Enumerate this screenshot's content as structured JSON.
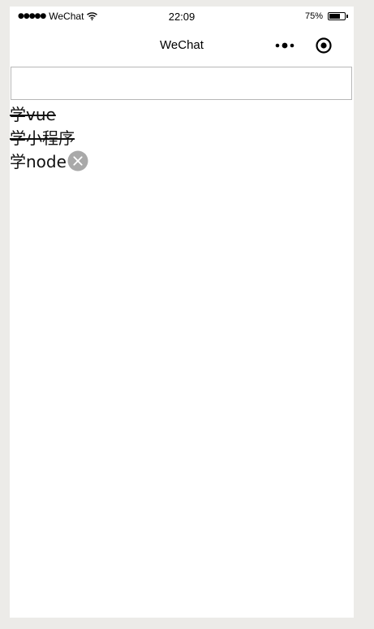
{
  "status_bar": {
    "signal": "●●●●●",
    "carrier": "WeChat",
    "time": "22:09",
    "battery": "75%",
    "battery_level": 0.75
  },
  "nav": {
    "title": "WeChat",
    "icons": [
      "more-icon",
      "record-icon"
    ]
  },
  "input": {
    "value": "",
    "placeholder": ""
  },
  "todos": [
    {
      "text": "学vue",
      "done": true
    },
    {
      "text": "学小程序",
      "done": true
    },
    {
      "text": "学node",
      "done": false
    }
  ],
  "colors": {
    "background": "#ecebe8",
    "page": "#ffffff",
    "delete_icon": "#a9a9a9"
  }
}
